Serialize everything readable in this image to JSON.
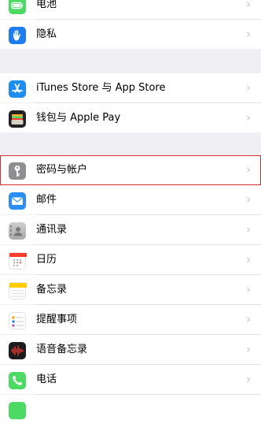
{
  "settings": {
    "items": [
      {
        "label": "电池",
        "icon": "battery-icon",
        "color": "#4cd964"
      },
      {
        "label": "隐私",
        "icon": "hand-icon",
        "color": "#1e7cf1"
      },
      {
        "label": "iTunes Store 与 App Store",
        "icon": "app-store-icon",
        "color": "#1d8ef1"
      },
      {
        "label": "钱包与 Apple Pay",
        "icon": "wallet-icon",
        "color": "#222222"
      },
      {
        "label": "密码与帐户",
        "icon": "key-icon",
        "color": "#8e8e93",
        "highlighted": true
      },
      {
        "label": "邮件",
        "icon": "mail-icon",
        "color": "#2a8ef5"
      },
      {
        "label": "通讯录",
        "icon": "contacts-icon",
        "color": "#b8b8b8"
      },
      {
        "label": "日历",
        "icon": "calendar-icon",
        "color": "#ffffff"
      },
      {
        "label": "备忘录",
        "icon": "notes-icon",
        "color": "#ffffff"
      },
      {
        "label": "提醒事项",
        "icon": "reminders-icon",
        "color": "#ffffff"
      },
      {
        "label": "语音备忘录",
        "icon": "voice-memos-icon",
        "color": "#1c1c1e"
      },
      {
        "label": "电话",
        "icon": "phone-icon",
        "color": "#4cd964"
      }
    ],
    "chevron": "›"
  }
}
